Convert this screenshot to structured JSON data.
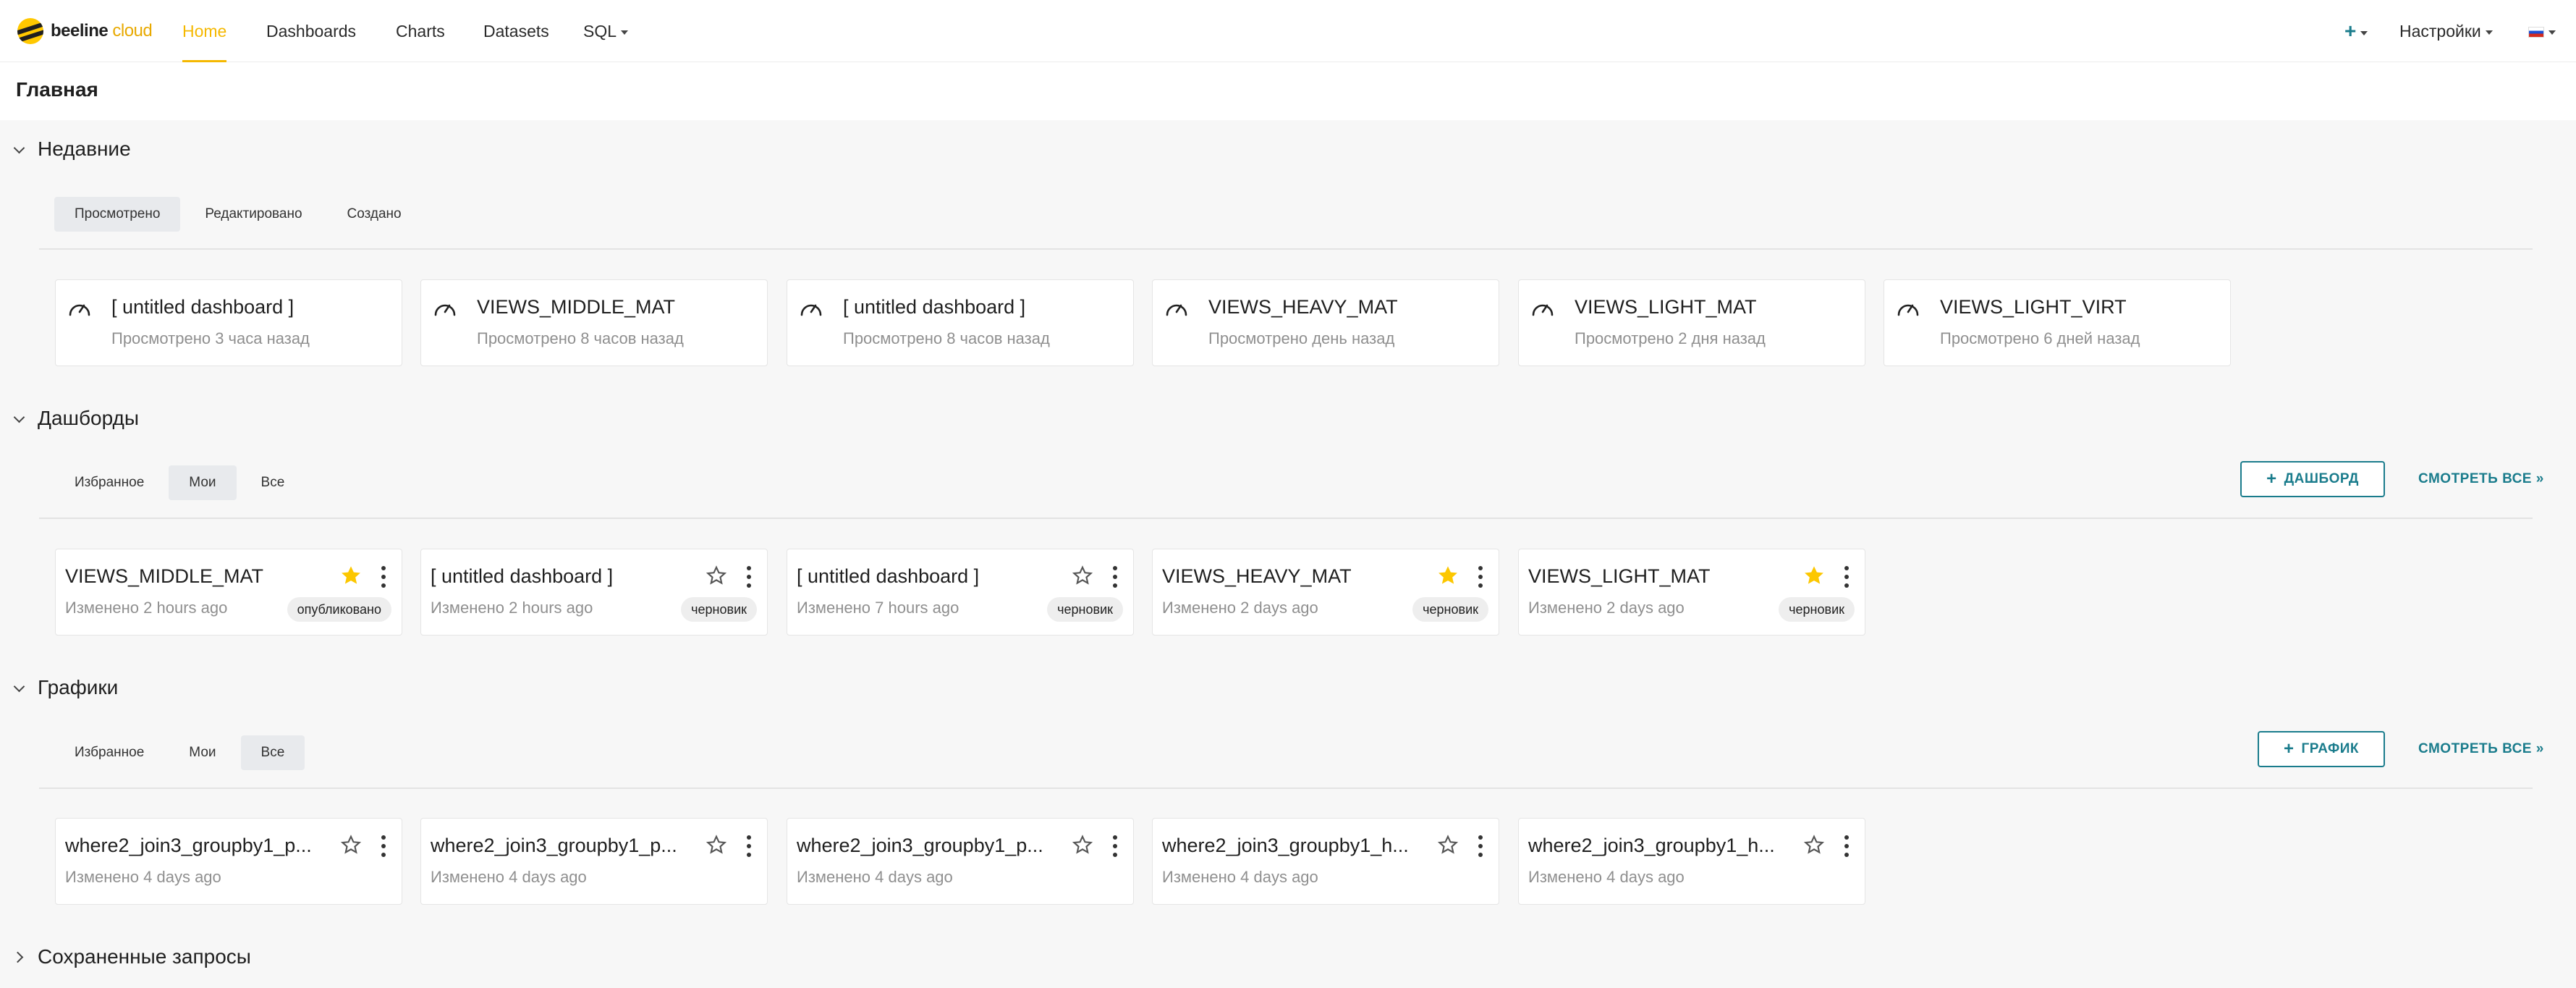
{
  "app": {
    "logo_primary": "beeline",
    "logo_secondary": "cloud"
  },
  "nav": {
    "items": [
      {
        "label": "Home",
        "active": true
      },
      {
        "label": "Dashboards"
      },
      {
        "label": "Charts"
      },
      {
        "label": "Datasets"
      },
      {
        "label": "SQL"
      }
    ],
    "plus_label": "+",
    "settings_label": "Настройки"
  },
  "page": {
    "title": "Главная"
  },
  "recent": {
    "title": "Недавние",
    "tabs": [
      "Просмотрено",
      "Редактировано",
      "Создано"
    ],
    "selected_tab": "Просмотрено",
    "cards": [
      {
        "title": "[ untitled dashboard ]",
        "subtitle": "Просмотрено 3 часа назад"
      },
      {
        "title": "VIEWS_MIDDLE_MAT",
        "subtitle": "Просмотрено 8 часов назад"
      },
      {
        "title": "[ untitled dashboard ]",
        "subtitle": "Просмотрено 8 часов назад"
      },
      {
        "title": "VIEWS_HEAVY_MAT",
        "subtitle": "Просмотрено день назад"
      },
      {
        "title": "VIEWS_LIGHT_MAT",
        "subtitle": "Просмотрено 2 дня назад"
      },
      {
        "title": "VIEWS_LIGHT_VIRT",
        "subtitle": "Просмотрено 6 дней назад"
      }
    ]
  },
  "dashboards": {
    "title": "Дашборды",
    "tabs": [
      "Избранное",
      "Мои",
      "Все"
    ],
    "selected_tab": "Мои",
    "add_button": "ДАШБОРД",
    "see_all": "СМОТРЕТЬ ВСЕ »",
    "cards": [
      {
        "title": "VIEWS_MIDDLE_MAT",
        "modified": "Изменено 2 hours ago",
        "status": "опубликовано",
        "favorite": true
      },
      {
        "title": "[ untitled dashboard ]",
        "modified": "Изменено 2 hours ago",
        "status": "черновик",
        "favorite": false
      },
      {
        "title": "[ untitled dashboard ]",
        "modified": "Изменено 7 hours ago",
        "status": "черновик",
        "favorite": false
      },
      {
        "title": "VIEWS_HEAVY_MAT",
        "modified": "Изменено 2 days ago",
        "status": "черновик",
        "favorite": true
      },
      {
        "title": "VIEWS_LIGHT_MAT",
        "modified": "Изменено 2 days ago",
        "status": "черновик",
        "favorite": true
      }
    ]
  },
  "charts": {
    "title": "Графики",
    "tabs": [
      "Избранное",
      "Мои",
      "Все"
    ],
    "selected_tab": "Все",
    "add_button": "ГРАФИК",
    "see_all": "СМОТРЕТЬ ВСЕ »",
    "cards": [
      {
        "title": "where2_join3_groupby1_p...",
        "modified": "Изменено 4 days ago",
        "favorite": false
      },
      {
        "title": "where2_join3_groupby1_p...",
        "modified": "Изменено 4 days ago",
        "favorite": false
      },
      {
        "title": "where2_join3_groupby1_p...",
        "modified": "Изменено 4 days ago",
        "favorite": false
      },
      {
        "title": "where2_join3_groupby1_h...",
        "modified": "Изменено 4 days ago",
        "favorite": false
      },
      {
        "title": "where2_join3_groupby1_h...",
        "modified": "Изменено 4 days ago",
        "favorite": false
      }
    ]
  },
  "saved_queries": {
    "title": "Сохраненные запросы"
  },
  "colors": {
    "accent": "#1a7c8c",
    "active_nav": "#f5b800",
    "star": "#fcc700"
  }
}
